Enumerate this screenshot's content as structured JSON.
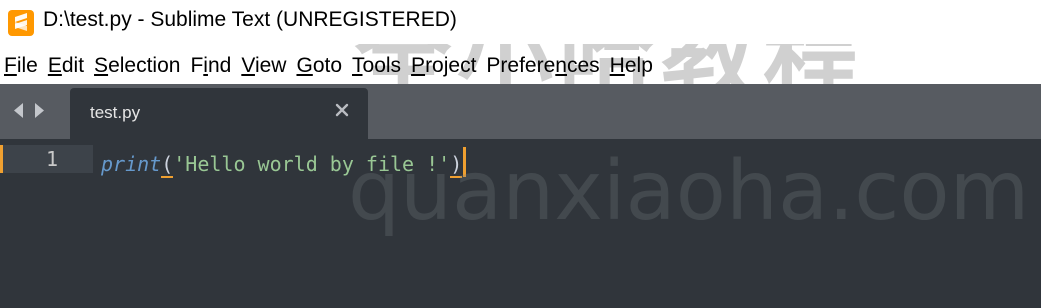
{
  "window": {
    "title": "D:\\test.py - Sublime Text (UNREGISTERED)",
    "icon": "sublime-text-icon"
  },
  "menu": [
    {
      "pre": "",
      "mnemonic": "F",
      "post": "ile"
    },
    {
      "pre": "",
      "mnemonic": "E",
      "post": "dit"
    },
    {
      "pre": "",
      "mnemonic": "S",
      "post": "election"
    },
    {
      "pre": "F",
      "mnemonic": "i",
      "post": "nd"
    },
    {
      "pre": "",
      "mnemonic": "V",
      "post": "iew"
    },
    {
      "pre": "",
      "mnemonic": "G",
      "post": "oto"
    },
    {
      "pre": "",
      "mnemonic": "T",
      "post": "ools"
    },
    {
      "pre": "",
      "mnemonic": "P",
      "post": "roject"
    },
    {
      "pre": "Prefere",
      "mnemonic": "n",
      "post": "ces"
    },
    {
      "pre": "",
      "mnemonic": "H",
      "post": "elp"
    }
  ],
  "tabs": [
    {
      "label": "test.py",
      "active": true
    }
  ],
  "editor": {
    "lines": [
      {
        "number": "1",
        "tokens": {
          "func": "print",
          "open_paren": "(",
          "string": "'Hello world by file !'",
          "close_paren": ")"
        }
      }
    ]
  },
  "watermark": {
    "cn": "全小哈教程",
    "en": "quanxiaoha.com"
  },
  "colors": {
    "accent": "#f0a030",
    "editor_bg": "#30353b",
    "tabbar_bg": "#575b61",
    "function": "#6699cc",
    "string": "#99c794"
  }
}
